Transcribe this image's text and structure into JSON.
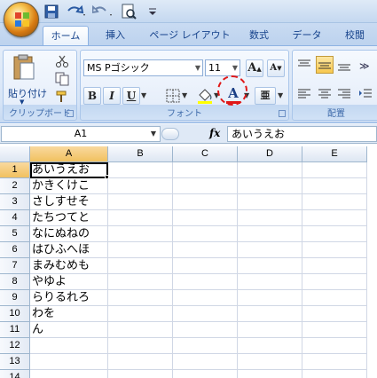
{
  "quick_access": {
    "icons": [
      "save-icon",
      "undo-icon",
      "redo-icon",
      "print-preview-icon",
      "customize-icon"
    ]
  },
  "tabs": [
    {
      "label": "ホーム",
      "active": true
    },
    {
      "label": "挿入",
      "active": false
    },
    {
      "label": "ページ レイアウト",
      "active": false
    },
    {
      "label": "数式",
      "active": false
    },
    {
      "label": "データ",
      "active": false
    },
    {
      "label": "校閲",
      "active": false
    }
  ],
  "ribbon": {
    "clipboard": {
      "paste_label": "貼り付け",
      "group_label": "クリップボード"
    },
    "font": {
      "font_name": "MS Pゴシック",
      "font_size": "11",
      "bold": "B",
      "italic": "I",
      "underline": "U",
      "font_color_glyph": "A",
      "grow_glyph": "A",
      "shrink_glyph": "A",
      "phonetic_glyph": "亜",
      "group_label": "フォント"
    },
    "alignment": {
      "group_label": "配置"
    }
  },
  "formula_bar": {
    "name_box": "A1",
    "fx_label": "fx",
    "content": "あいうえお"
  },
  "sheet": {
    "columns": [
      "A",
      "B",
      "C",
      "D",
      "E"
    ],
    "selected_column": "A",
    "rows": [
      {
        "num": "1",
        "a": "あいうえお"
      },
      {
        "num": "2",
        "a": "かきくけこ"
      },
      {
        "num": "3",
        "a": "さしすせそ"
      },
      {
        "num": "4",
        "a": "たちつてと"
      },
      {
        "num": "5",
        "a": "なにぬねの"
      },
      {
        "num": "6",
        "a": "はひふへほ"
      },
      {
        "num": "7",
        "a": "まみむめも"
      },
      {
        "num": "8",
        "a": "やゆよ"
      },
      {
        "num": "9",
        "a": "らりるれろ"
      },
      {
        "num": "10",
        "a": "わを"
      },
      {
        "num": "11",
        "a": "ん"
      },
      {
        "num": "12",
        "a": ""
      },
      {
        "num": "13",
        "a": ""
      },
      {
        "num": "14",
        "a": ""
      }
    ]
  },
  "colors": {
    "accent": "#15428b",
    "highlight_circle": "#e01818",
    "font_color_bar": "#e01818",
    "fill_color_bar": "#ffff00"
  }
}
